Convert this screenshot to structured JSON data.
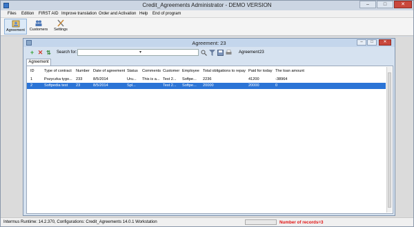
{
  "window": {
    "title": "Credit_Agreements  Administrator  - DEMO VERSION",
    "controls": [
      "–",
      "□",
      "✕"
    ]
  },
  "menu": [
    "Files",
    "Edition",
    "FIRST AID",
    "Improve translation",
    "Order and Activation",
    "Help",
    "End of program"
  ],
  "toolbar": {
    "agreement": "Agreement",
    "customers": "Customers",
    "settings": "Settings"
  },
  "child": {
    "title": "Agreement:  23",
    "controls": [
      "–",
      "□",
      "✕"
    ]
  },
  "child_toolbar": {
    "search_label": "Search for:",
    "search_value": "",
    "agreement_label": "Agreement:",
    "agreement_value": "23"
  },
  "tabs": [
    "Agreement"
  ],
  "table": {
    "columns": [
      "ID",
      "Type of contract",
      "Number",
      "Date of agreement",
      "Status",
      "Comments",
      "Customer",
      "Employee",
      "Total obligations to repay",
      "Paid for today",
      "The loan amount"
    ],
    "rows": [
      [
        "1",
        "Pozyczka tygo...",
        "233",
        "8/5/2014",
        "Uru...",
        "This is a...",
        "Test 2...",
        "Softpe...",
        "2236",
        "41200",
        "-38964"
      ],
      [
        "2",
        "Softpedia test",
        "23",
        "8/5/2014",
        "Spl...",
        "",
        "Test 2...",
        "Softpe...",
        "20000",
        "20000",
        "0"
      ]
    ]
  },
  "statusbar": {
    "text": "Intermus Runtime: 14.2.370,  Configurations: Credit_Agreements 14.0.1 Workstation",
    "records": "Number of records=3"
  },
  "colors": {
    "selection": "#2b74d6",
    "records_text": "#e01010",
    "add_icon": "#3aa43a",
    "delete_icon": "#d23a2a"
  }
}
